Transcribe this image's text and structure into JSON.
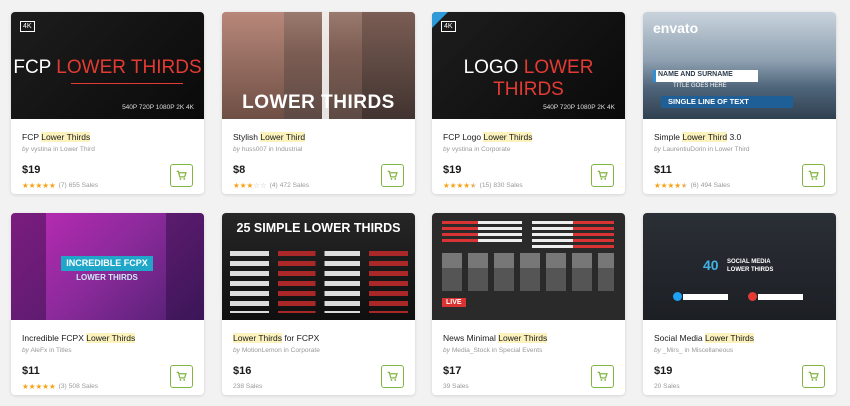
{
  "cards": [
    {
      "title_pre": "FCP ",
      "title_hl": "Lower Thirds",
      "title_post": "",
      "author": "vystina",
      "category": "Lower Third",
      "price": "$19",
      "stars": 5,
      "reviews": "(7)",
      "sales": "655 Sales",
      "thumb_text": "FCP LOWER THIRDS",
      "thumb_text_a": "FCP ",
      "thumb_text_b": "LOWER THIRDS",
      "thumb_sub": "540P 720P 1080P 2K 4K",
      "badge": "4K"
    },
    {
      "title_pre": "Stylish ",
      "title_hl": "Lower Third",
      "title_post": "",
      "author": "huss007",
      "category": "Industrial",
      "price": "$8",
      "stars": 3,
      "reviews": "(4)",
      "sales": "472 Sales",
      "thumb_text": "LOWER THIRDS"
    },
    {
      "title_pre": "FCP Logo ",
      "title_hl": "Lower Thirds",
      "title_post": "",
      "author": "vystina",
      "category": "Corporate",
      "price": "$19",
      "stars": 4.5,
      "reviews": "(15)",
      "sales": "830 Sales",
      "thumb_text_a": "LOGO ",
      "thumb_text_b": "LOWER THIRDS",
      "thumb_sub": "540P 720P 1080P 2K 4K",
      "badge": "4K"
    },
    {
      "title_pre": "Simple ",
      "title_hl": "Lower Third",
      "title_post": " 3.0",
      "author": "LaurentiuDorin",
      "category": "Lower Third",
      "price": "$11",
      "stars": 4.5,
      "reviews": "(6)",
      "sales": "494 Sales",
      "logo": "envato",
      "name_line": "NAME AND SURNAME",
      "title_line": "TITLE GOES HERE",
      "single_line": "SINGLE LINE OF TEXT"
    },
    {
      "title_pre": "Incredible FCPX ",
      "title_hl": "Lower Thirds",
      "title_post": "",
      "author": "AleFx",
      "category": "Titles",
      "price": "$11",
      "stars": 5,
      "reviews": "(3)",
      "sales": "508 Sales",
      "thumb_line1": "INCREDIBLE FCPX",
      "thumb_line2": "LOWER THIRDS"
    },
    {
      "title_pre": "",
      "title_hl": "Lower Thirds",
      "title_post": " for FCPX",
      "author": "MotionLemon",
      "category": "Corporate",
      "price": "$16",
      "stars": 0,
      "reviews": "",
      "sales": "238 Sales",
      "thumb_text": "25 SIMPLE LOWER THIRDS"
    },
    {
      "title_pre": "News Minimal ",
      "title_hl": "Lower Thirds",
      "title_post": "",
      "author": "Media_Stock",
      "category": "Special Events",
      "price": "$17",
      "stars": 0,
      "reviews": "",
      "sales": "39 Sales",
      "thumb_text": "LIVE"
    },
    {
      "title_pre": "Social Media ",
      "title_hl": "Lower Thirds",
      "title_post": "",
      "author": "_Mirs_",
      "category": "Miscellaneous",
      "price": "$19",
      "stars": 0,
      "reviews": "",
      "sales": "20 Sales",
      "thumb_num": "40",
      "thumb_line1": "SOCIAL MEDIA",
      "thumb_line2": "LOWER THIRDS"
    }
  ],
  "by_label": "by",
  "in_label": "in",
  "colors": {
    "accent_green": "#82b541",
    "star": "#f8a315",
    "highlight": "#fbf2bd",
    "red": "#e33b33"
  }
}
